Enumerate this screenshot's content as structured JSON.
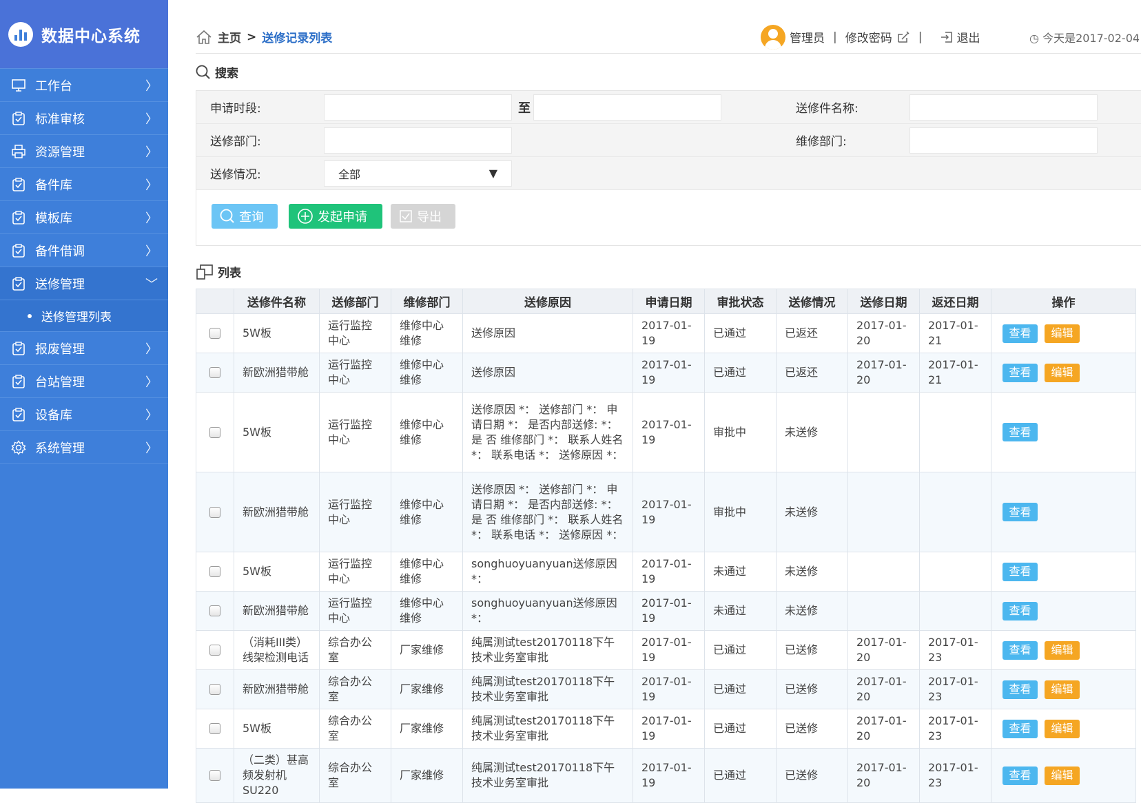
{
  "app": {
    "title": "数据中心系统"
  },
  "sidebar": {
    "items": [
      {
        "label": "工作台",
        "icon": "monitor-icon"
      },
      {
        "label": "标准审核",
        "icon": "clipboard-check-icon"
      },
      {
        "label": "资源管理",
        "icon": "printer-icon"
      },
      {
        "label": "备件库",
        "icon": "clipboard-check-icon"
      },
      {
        "label": "模板库",
        "icon": "clipboard-check-icon"
      },
      {
        "label": "备件借调",
        "icon": "clipboard-check-icon"
      },
      {
        "label": "送修管理",
        "icon": "clipboard-check-icon",
        "expanded": true
      },
      {
        "label": "报废管理",
        "icon": "clipboard-check-icon"
      },
      {
        "label": "台站管理",
        "icon": "clipboard-check-icon"
      },
      {
        "label": "设备库",
        "icon": "clipboard-check-icon"
      },
      {
        "label": "系统管理",
        "icon": "gear-icon"
      }
    ],
    "subitem": "送修管理列表"
  },
  "header": {
    "breadcrumb_home": "主页",
    "breadcrumb_sep": ">",
    "breadcrumb_current": "送修记录列表",
    "user": "管理员",
    "bar": "|",
    "change_password": "修改密码",
    "logout": "退出",
    "date": "今天是2017-02-04"
  },
  "search": {
    "title": "搜索",
    "apply_period_label": "申请时段:",
    "to_label": "至",
    "part_name_label": "送修件名称:",
    "send_dept_label": "送修部门:",
    "repair_dept_label": "维修部门:",
    "status_label": "送修情况:",
    "status_value": "全部",
    "query_btn": "查询",
    "apply_btn": "发起申请",
    "export_btn": "导出"
  },
  "list": {
    "title": "列表",
    "columns": [
      "送修件名称",
      "送修部门",
      "维修部门",
      "送修原因",
      "申请日期",
      "审批状态",
      "送修情况",
      "送修日期",
      "返还日期",
      "操作"
    ],
    "view_label": "查看",
    "edit_label": "编辑",
    "rows": [
      {
        "name": "5W板",
        "send": "运行监控中心",
        "repair": "维修中心维修",
        "reason": "送修原因",
        "apply": "2017-01-19",
        "approval": "已通过",
        "status": "已返还",
        "sent": "2017-01-20",
        "returned": "2017-01-21",
        "edit": true
      },
      {
        "name": "新欧洲猎带舱",
        "send": "运行监控中心",
        "repair": "维修中心维修",
        "reason": "送修原因",
        "apply": "2017-01-19",
        "approval": "已通过",
        "status": "已返还",
        "sent": "2017-01-20",
        "returned": "2017-01-21",
        "edit": true
      },
      {
        "name": "5W板",
        "send": "运行监控中心",
        "repair": "维修中心维修",
        "reason": "送修原因 *： 送修部门 *： 申请日期 *： 是否内部送修: *： 是 否 维修部门 *： 联系人姓名 *： 联系电话 *： 送修原因 *：",
        "apply": "2017-01-19",
        "approval": "审批中",
        "status": "未送修",
        "sent": "",
        "returned": "",
        "edit": false
      },
      {
        "name": "新欧洲猎带舱",
        "send": "运行监控中心",
        "repair": "维修中心维修",
        "reason": "送修原因 *： 送修部门 *： 申请日期 *： 是否内部送修: *： 是 否 维修部门 *： 联系人姓名 *： 联系电话 *： 送修原因 *：",
        "apply": "2017-01-19",
        "approval": "审批中",
        "status": "未送修",
        "sent": "",
        "returned": "",
        "edit": false
      },
      {
        "name": "5W板",
        "send": "运行监控中心",
        "repair": "维修中心维修",
        "reason": "songhuoyuanyuan送修原因 *：",
        "apply": "2017-01-19",
        "approval": "未通过",
        "status": "未送修",
        "sent": "",
        "returned": "",
        "edit": false
      },
      {
        "name": "新欧洲猎带舱",
        "send": "运行监控中心",
        "repair": "维修中心维修",
        "reason": "songhuoyuanyuan送修原因 *：",
        "apply": "2017-01-19",
        "approval": "未通过",
        "status": "未送修",
        "sent": "",
        "returned": "",
        "edit": false
      },
      {
        "name": "（消耗III类）线架检测电话",
        "send": "综合办公室",
        "repair": "厂家维修",
        "reason": "纯属测试test20170118下午技术业务室审批",
        "apply": "2017-01-19",
        "approval": "已通过",
        "status": "已送修",
        "sent": "2017-01-20",
        "returned": "2017-01-23",
        "edit": true
      },
      {
        "name": "新欧洲猎带舱",
        "send": "综合办公室",
        "repair": "厂家维修",
        "reason": "纯属测试test20170118下午技术业务室审批",
        "apply": "2017-01-19",
        "approval": "已通过",
        "status": "已送修",
        "sent": "2017-01-20",
        "returned": "2017-01-23",
        "edit": true
      },
      {
        "name": "5W板",
        "send": "综合办公室",
        "repair": "厂家维修",
        "reason": "纯属测试test20170118下午技术业务室审批",
        "apply": "2017-01-19",
        "approval": "已通过",
        "status": "已送修",
        "sent": "2017-01-20",
        "returned": "2017-01-23",
        "edit": true
      },
      {
        "name": "（二类）甚高频发射机SU220",
        "send": "综合办公室",
        "repair": "厂家维修",
        "reason": "纯属测试test20170118下午技术业务室审批",
        "apply": "2017-01-19",
        "approval": "已通过",
        "status": "已送修",
        "sent": "2017-01-20",
        "returned": "2017-01-23",
        "edit": true
      }
    ]
  }
}
